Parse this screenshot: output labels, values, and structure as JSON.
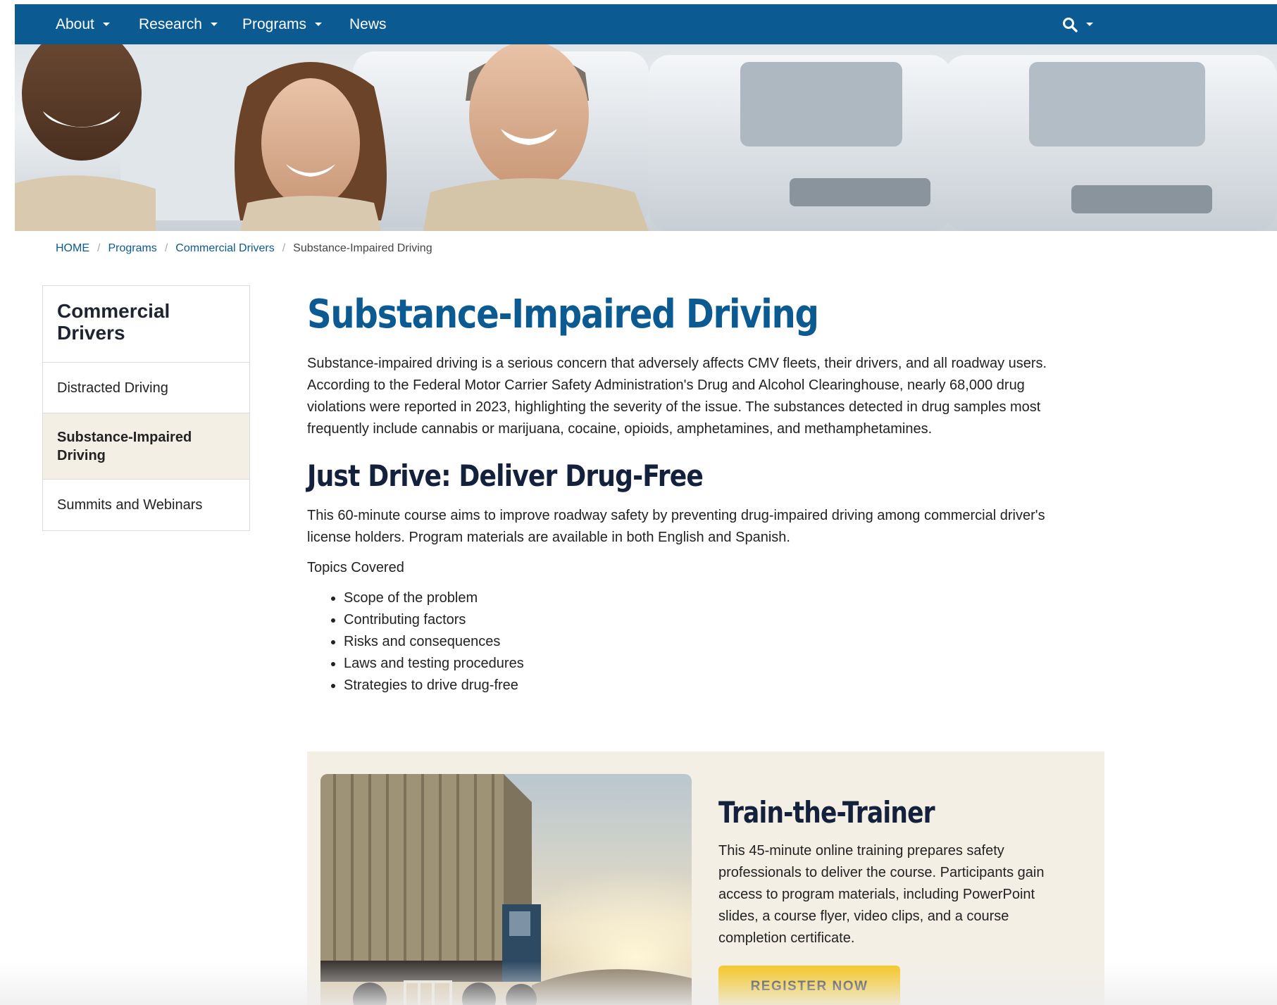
{
  "nav": {
    "items": [
      {
        "label": "About",
        "has_dropdown": true
      },
      {
        "label": "Research",
        "has_dropdown": true
      },
      {
        "label": "Programs",
        "has_dropdown": true
      },
      {
        "label": "News",
        "has_dropdown": false
      }
    ],
    "search_icon": "search-icon",
    "background_color": "#0b5a92"
  },
  "breadcrumb": {
    "items": [
      "HOME",
      "Programs",
      "Commercial Drivers"
    ],
    "current": "Substance-Impaired Driving"
  },
  "sidebar": {
    "title": "Commercial Drivers",
    "items": [
      {
        "label": "Distracted Driving",
        "active": false
      },
      {
        "label": "Substance-Impaired Driving",
        "active": true
      },
      {
        "label": "Summits and Webinars",
        "active": false
      }
    ]
  },
  "main": {
    "title": "Substance-Impaired Driving",
    "intro": "Substance-impaired driving is a serious concern that adversely affects CMV fleets, their drivers, and all roadway users. According to the Federal Motor Carrier Safety Administration's Drug and Alcohol Clearinghouse, nearly 68,000 drug violations were reported in 2023, highlighting the severity of the issue. The substances detected in drug samples most frequently include cannabis or marijuana, cocaine, opioids, amphetamines, and methamphetamines.",
    "section_title": "Just Drive: Deliver Drug-Free",
    "course_description": "This 60-minute course aims to improve roadway safety by preventing drug-impaired driving among commercial driver's license holders. Program materials are available in both English and Spanish.",
    "topics_label": "Topics Covered",
    "topics": [
      "Scope of the problem",
      "Contributing factors",
      "Risks and consequences",
      "Laws and testing procedures",
      "Strategies to drive drug-free"
    ]
  },
  "card": {
    "title": "Train-the-Trainer",
    "text": "This 45-minute online training prepares safety professionals to deliver the course. Participants gain access to program materials, including PowerPoint slides, a course flyer, video clips, and a course completion certificate.",
    "button_label": "REGISTER NOW",
    "button_color": "#f5c41a",
    "background_color": "#f3efe5"
  }
}
